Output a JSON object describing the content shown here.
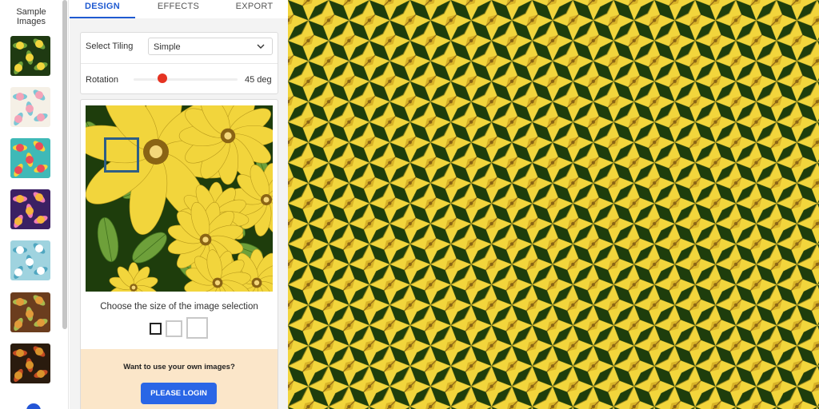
{
  "samples": {
    "title": "Sample Images",
    "thumbs": [
      {
        "name": "yellow-flowers",
        "bg": "#1f3a12",
        "fg": "#f2d53c",
        "accent": "#6ea03a"
      },
      {
        "name": "pastel-petals",
        "bg": "#f5f0e6",
        "fg": "#f4a3b8",
        "accent": "#7cc7d6"
      },
      {
        "name": "teal-leaves",
        "bg": "#3fb9b7",
        "fg": "#e94c5a",
        "accent": "#f4d23c"
      },
      {
        "name": "dark-donuts",
        "bg": "#3b2063",
        "fg": "#f6b53c",
        "accent": "#f07cb6"
      },
      {
        "name": "blue-tropical",
        "bg": "#9fd3df",
        "fg": "#ffffff",
        "accent": "#4fa6c0"
      },
      {
        "name": "brown-pineapples",
        "bg": "#6b3d1e",
        "fg": "#e29b3a",
        "accent": "#a7b94c"
      },
      {
        "name": "ornament-stripes",
        "bg": "#2a1b0e",
        "fg": "#d9932b",
        "accent": "#c24a22"
      }
    ]
  },
  "tabs": [
    {
      "id": "design",
      "label": "DESIGN",
      "active": true
    },
    {
      "id": "effects",
      "label": "EFFECTS",
      "active": false
    },
    {
      "id": "export",
      "label": "EXPORT",
      "active": false
    }
  ],
  "tiling": {
    "label": "Select Tiling",
    "value": "Simple"
  },
  "rotation": {
    "label": "Rotation",
    "value": "45 deg",
    "fraction": 0.28
  },
  "selection": {
    "caption": "Choose the size of the image selection",
    "selected": "small"
  },
  "login": {
    "prompt": "Want to use your own images?",
    "button": "PLEASE LOGIN"
  },
  "colors": {
    "accent": "#1f5ad1",
    "button": "#2a66e6",
    "knob": "#e53322",
    "flower_yellow": "#f2d53c",
    "flower_dark": "#1e3d0c",
    "leaf_green": "#6ea03a"
  }
}
